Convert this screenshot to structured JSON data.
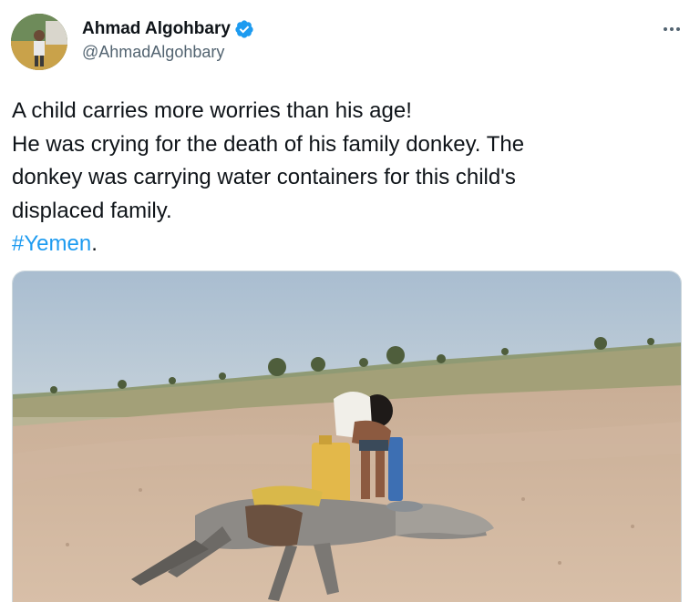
{
  "author": {
    "display_name": "Ahmad Algohbary",
    "handle": "@AhmadAlgohbary",
    "verified": true,
    "avatar_icon": "profile-photo"
  },
  "tweet": {
    "lines": [
      "A child carries more worries than his age!",
      "He was crying for the death of his family donkey. The",
      "donkey was carrying water containers for this child's",
      "displaced family."
    ],
    "hashtag": "#Yemen",
    "hashtag_suffix": "."
  },
  "menu": {
    "icon": "more-options-icon"
  },
  "media": {
    "kind": "photo"
  },
  "colors": {
    "link": "#1d9bf0",
    "verified": "#1d9bf0",
    "secondary_text": "#536471",
    "primary_text": "#0f1419"
  }
}
